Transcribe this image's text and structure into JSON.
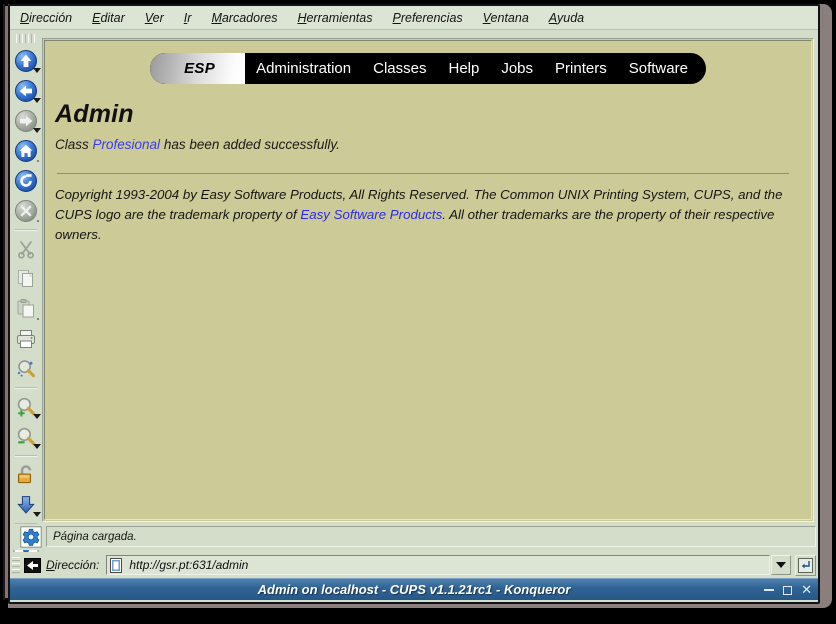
{
  "window": {
    "title": "Admin on localhost - CUPS v1.1.21rc1 - Konqueror",
    "controls": {
      "minimize": "minimize",
      "maximize": "maximize",
      "close": "close"
    }
  },
  "menubar": {
    "items": [
      {
        "accel": "D",
        "rest": "irección"
      },
      {
        "accel": "E",
        "rest": "ditar"
      },
      {
        "accel": "V",
        "rest": "er"
      },
      {
        "accel": "I",
        "rest": "r"
      },
      {
        "accel": "M",
        "rest": "arcadores"
      },
      {
        "accel": "H",
        "rest": "erramientas"
      },
      {
        "accel": "P",
        "rest": "referencias"
      },
      {
        "accel": "V",
        "rest": "entana"
      },
      {
        "accel": "A",
        "rest": "yuda"
      }
    ]
  },
  "toolbar": {
    "buttons": [
      {
        "name": "up-arrow-icon",
        "label": "Arriba",
        "enabled": true,
        "caret": true
      },
      {
        "name": "back-arrow-icon",
        "label": "Atrás",
        "enabled": true,
        "caret": true
      },
      {
        "name": "forward-arrow-icon",
        "label": "Adelante",
        "enabled": false,
        "caret": true
      },
      {
        "name": "home-icon",
        "label": "Inicio",
        "enabled": true,
        "caret": false
      },
      {
        "name": "reload-icon",
        "label": "Recargar",
        "enabled": true,
        "caret": false
      },
      {
        "name": "stop-icon",
        "label": "Detener",
        "enabled": false,
        "caret": false
      },
      {
        "name": "cut-scissors-icon",
        "label": "Cortar",
        "enabled": false,
        "caret": false
      },
      {
        "name": "copy-icon",
        "label": "Copiar",
        "enabled": false,
        "caret": false
      },
      {
        "name": "paste-icon",
        "label": "Pegar",
        "enabled": false,
        "caret": false
      },
      {
        "name": "print-icon",
        "label": "Imprimir",
        "enabled": true,
        "caret": false
      },
      {
        "name": "find-icon",
        "label": "Buscar",
        "enabled": true,
        "caret": false
      },
      {
        "name": "zoom-in-icon",
        "label": "Ampliar",
        "enabled": true,
        "caret": true
      },
      {
        "name": "zoom-out-icon",
        "label": "Reducir",
        "enabled": true,
        "caret": true
      },
      {
        "name": "padlock-open-icon",
        "label": "Seguridad",
        "enabled": true,
        "caret": false
      },
      {
        "name": "download-arrow-icon",
        "label": "Descargas",
        "enabled": true,
        "caret": true
      },
      {
        "name": "gear-icon",
        "label": "Konqueror",
        "enabled": true,
        "caret": false
      }
    ]
  },
  "page": {
    "brand_tab": "ESP",
    "nav_tabs": [
      {
        "label": "Administration",
        "active": true
      },
      {
        "label": "Classes",
        "active": false
      },
      {
        "label": "Help",
        "active": false
      },
      {
        "label": "Jobs",
        "active": false
      },
      {
        "label": "Printers",
        "active": false
      },
      {
        "label": "Software",
        "active": false
      }
    ],
    "heading": "Admin",
    "status_prefix": "Class ",
    "status_link": "Profesional",
    "status_suffix": " has been added successfully.",
    "copyright_part1": "Copyright 1993-2004 by Easy Software Products, All Rights Reserved. The Common UNIX Printing System, CUPS, and the CUPS logo are the trademark property of ",
    "copyright_link": "Easy Software Products",
    "copyright_part2": ". All other trademarks are the property of their respective owners.",
    "link_color": "#3a3af0",
    "background_color": "#ccca96"
  },
  "statusbar": {
    "text": "Página cargada.",
    "gear_icon": "gear-icon"
  },
  "address": {
    "icon": "location-arrow-icon",
    "label_accel": "D",
    "label_rest": "irección:",
    "page_icon": "page-icon",
    "url": "http://gsr.pt:631/admin",
    "placeholder": "http://",
    "dropdown_icon": "chevron-down-icon",
    "go_icon": "enter-key-icon"
  }
}
